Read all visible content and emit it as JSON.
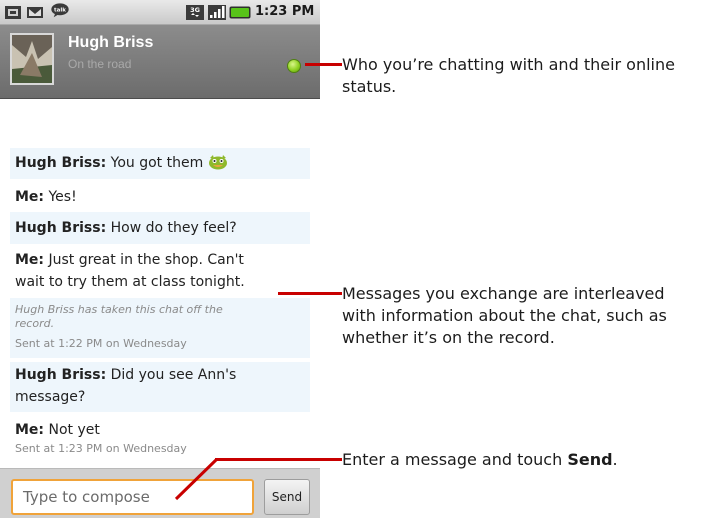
{
  "status_bar": {
    "time": "1:23 PM",
    "left_icons": [
      "sim-card-icon",
      "gmail-icon",
      "talk-icon"
    ],
    "right_icons": [
      "3g-icon",
      "signal-icon",
      "battery-icon"
    ]
  },
  "contact": {
    "name": "Hugh Briss",
    "status": "On the road",
    "presence_color": "#8fd122"
  },
  "messages": [
    {
      "sender": "Hugh Briss:",
      "text": "You got them",
      "emoticon": true
    },
    {
      "sender": "Me:",
      "text": "Yes!"
    },
    {
      "sender": "Hugh Briss:",
      "text": "How do they feel?"
    },
    {
      "sender": "Me:",
      "text_line1": "Just great in the shop. Can't",
      "text_line2": "wait to try them at class tonight."
    },
    {
      "note_line1": "Hugh Briss has taken this chat off the",
      "note_line2": "record.",
      "sent": "Sent at 1:22 PM on Wednesday"
    },
    {
      "sender": "Hugh Briss:",
      "text_line1": "Did you see Ann's",
      "text_line2": "message?"
    },
    {
      "sender": "Me:",
      "text": "Not yet",
      "sent": "Sent at 1:23 PM on Wednesday"
    }
  ],
  "compose": {
    "placeholder": "Type to compose",
    "send_label": "Send"
  },
  "callouts": {
    "contact_line1": "Who you’re chatting with and their online",
    "contact_line2": "status.",
    "messages_line1": "Messages you exchange are interleaved",
    "messages_line2": "with information about the chat, such as",
    "messages_line3": "whether it’s on the record.",
    "send_prefix": "Enter a message and touch ",
    "send_word": "Send",
    "send_suffix": "."
  },
  "colors": {
    "callout_line": "#c80000",
    "compose_focus": "#f0a33a",
    "message_shade": "#eef6fc"
  }
}
